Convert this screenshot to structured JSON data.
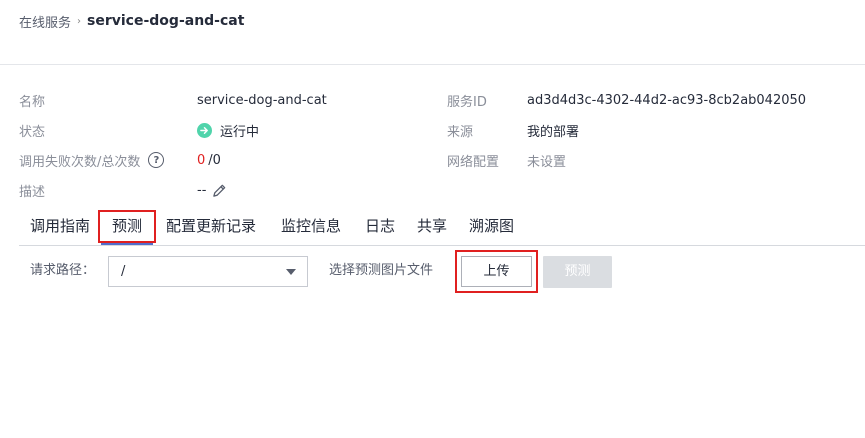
{
  "breadcrumb": {
    "parent": "在线服务",
    "current": "service-dog-and-cat"
  },
  "info": {
    "name_label": "名称",
    "name_value": "service-dog-and-cat",
    "status_label": "状态",
    "status_value": "运行中",
    "calls_label": "调用失败次数/总次数",
    "calls_failed": "0",
    "calls_total": "/0",
    "desc_label": "描述",
    "desc_value": "--",
    "service_id_label": "服务ID",
    "service_id_value": "ad3d4d3c-4302-44d2-ac93-8cb2ab042050",
    "source_label": "来源",
    "source_value": "我的部署",
    "network_label": "网络配置",
    "network_value": "未设置"
  },
  "tabs": [
    "调用指南",
    "预测",
    "配置更新记录",
    "监控信息",
    "日志",
    "共享",
    "溯源图"
  ],
  "active_tab": "预测",
  "predict": {
    "path_label": "请求路径：",
    "path_value": "/",
    "file_label": "选择预测图片文件",
    "upload_label": "上传",
    "predict_label": "预测"
  },
  "colors": {
    "status_green": "#50d4ab",
    "accent_red": "#e02020",
    "tab_underline": "#526ecc",
    "disabled_button": "#dadde1"
  },
  "icons": {
    "status": "arrow-right-circle-icon",
    "help": "question-circle-icon",
    "edit": "pencil-icon",
    "select_caret": "caret-down-icon",
    "breadcrumb_sep": "chevron-right-icon"
  }
}
